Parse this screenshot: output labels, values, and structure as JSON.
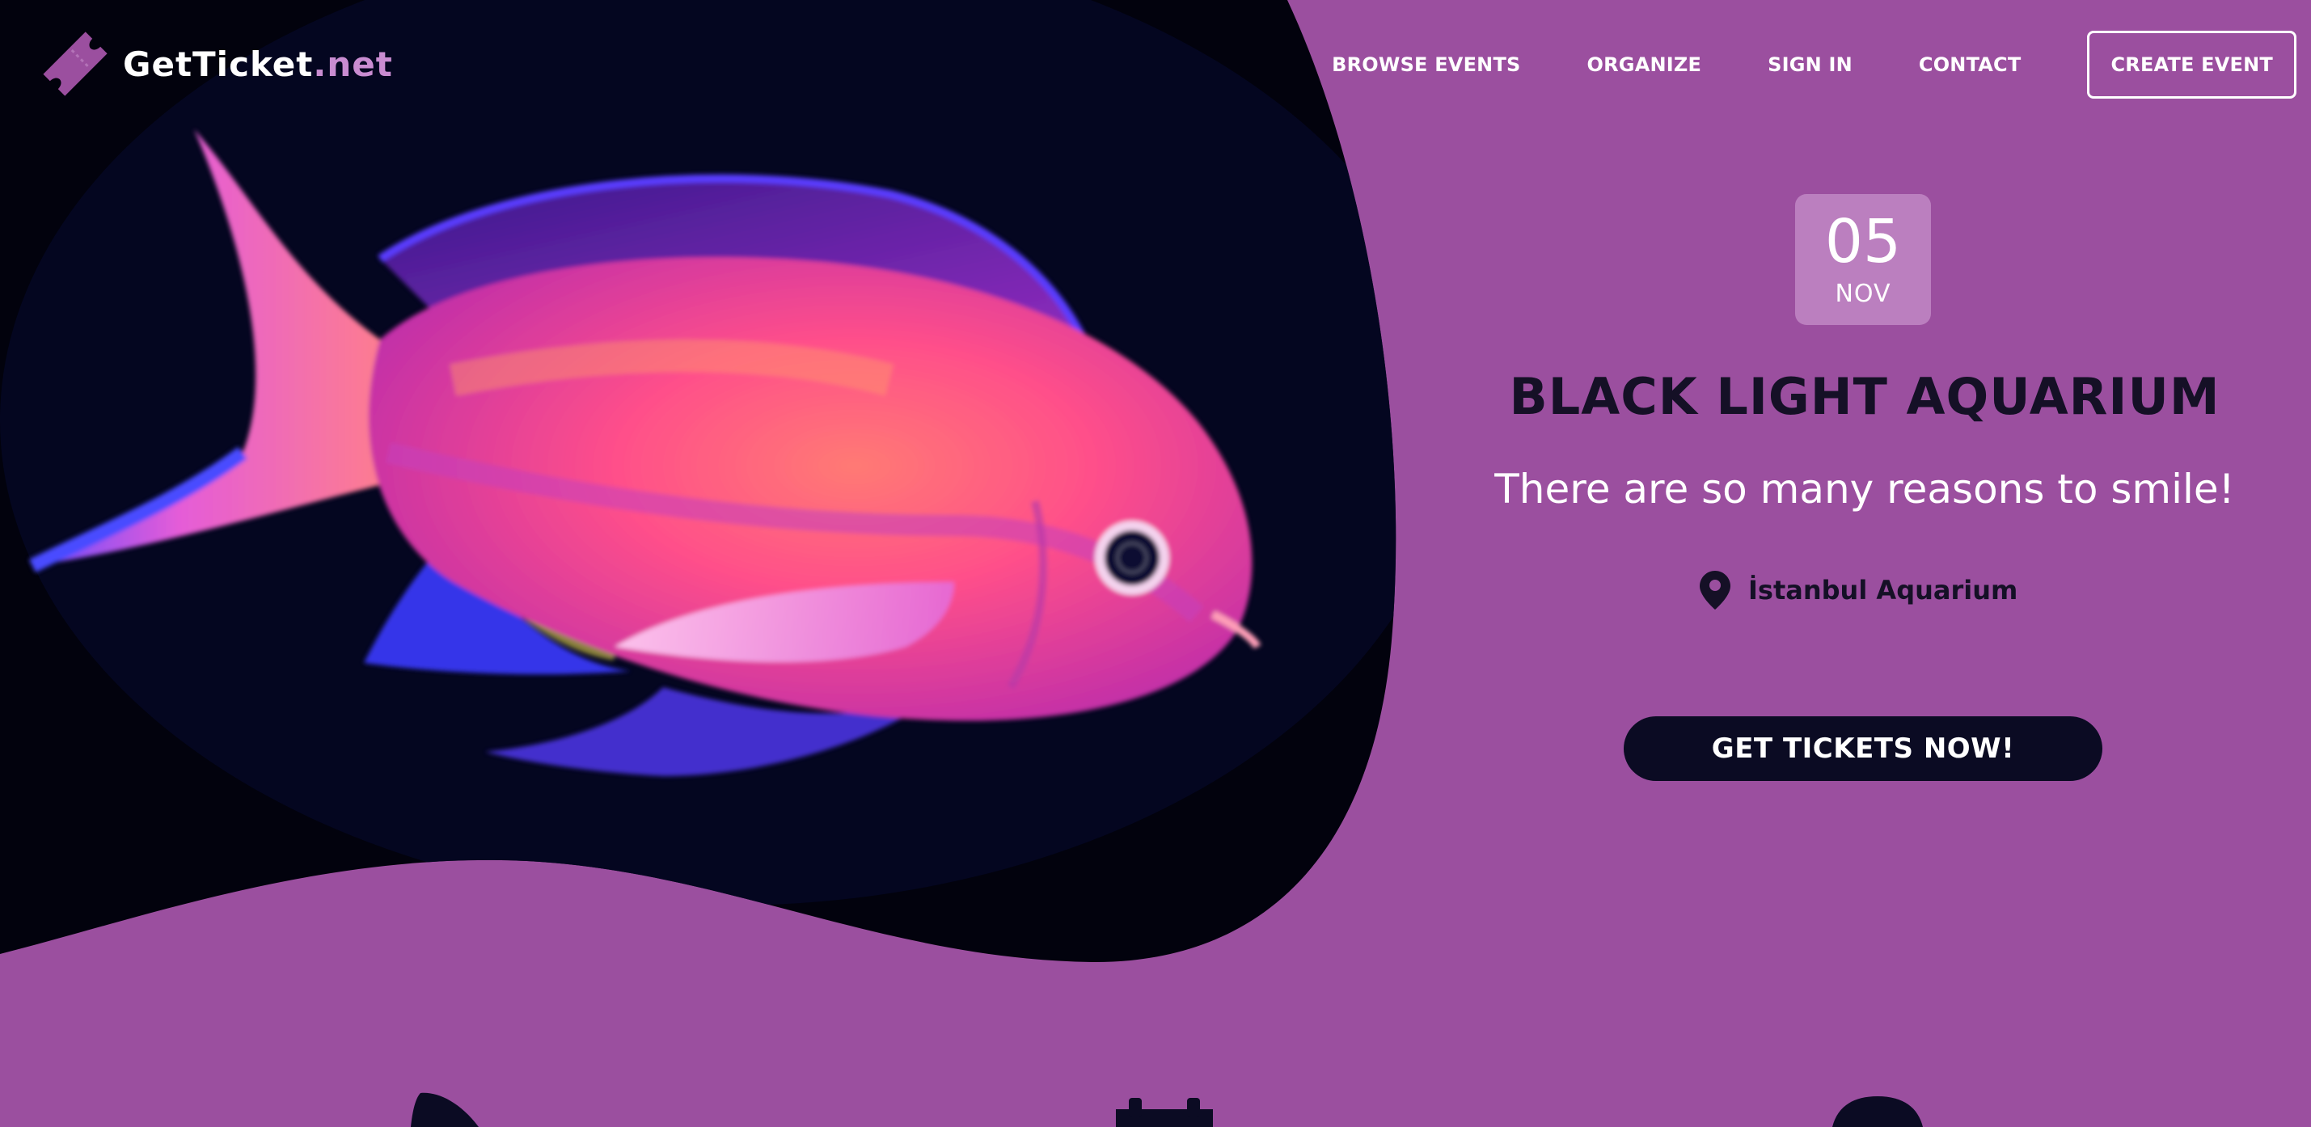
{
  "brand": {
    "name": "GetTicket",
    "tld": ".net",
    "icon": "ticket-icon"
  },
  "nav": {
    "items": [
      "BROWSE EVENTS",
      "ORGANIZE",
      "SIGN IN",
      "CONTACT"
    ],
    "create_label": "CREATE EVENT"
  },
  "event": {
    "day": "05",
    "month": "NOV",
    "title": "BLACK LIGHT AQUARIUM",
    "tagline": "There are so many reasons to smile!",
    "location": "İstanbul Aquarium",
    "location_icon": "map-pin-icon",
    "cta_label": "GET TICKETS NOW!"
  },
  "features": {
    "icons": [
      "shark-fin-icon",
      "calendar-icon",
      "circle-icon"
    ]
  },
  "colors": {
    "background": "#9b4f9f",
    "accent_light": "#c98cd1",
    "dark": "#151026",
    "button": "#0b0b23",
    "badge": "#bb7fbf"
  }
}
